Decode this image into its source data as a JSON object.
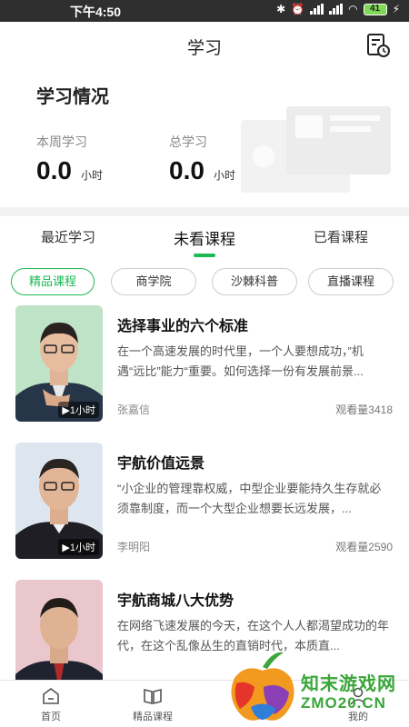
{
  "status_bar": {
    "time": "下午4:50",
    "battery": "41"
  },
  "header": {
    "title": "学习"
  },
  "summary": {
    "heading": "学习情况",
    "week_label": "本周学习",
    "week_value": "0.0",
    "week_unit": "小时",
    "total_label": "总学习",
    "total_value": "0.0",
    "total_unit": "小时"
  },
  "tabs": [
    {
      "label": "最近学习",
      "active": false
    },
    {
      "label": "未看课程",
      "active": true
    },
    {
      "label": "已看课程",
      "active": false
    }
  ],
  "categories": [
    {
      "label": "精品课程",
      "active": true
    },
    {
      "label": "商学院",
      "active": false
    },
    {
      "label": "沙棘科普",
      "active": false
    },
    {
      "label": "直播课程",
      "active": false
    }
  ],
  "courses": [
    {
      "title": "选择事业的六个标准",
      "description": "在一个高速发展的时代里，一个人要想成功，”机遇“远比”能力“重要。如何选择一份有发展前景...",
      "author": "张嘉信",
      "views": "观看量3418",
      "duration": "▶1小时"
    },
    {
      "title": "宇航价值远景",
      "description": "“小企业的管理靠权威，中型企业要能持久生存就必须靠制度，而一个大型企业想要长远发展，...",
      "author": "李明阳",
      "views": "观看量2590",
      "duration": "▶1小时"
    },
    {
      "title": "宇航商城八大优势",
      "description": "在网络飞速发展的今天，在这个人人都渴望成功的年代，在这个乱像丛生的直销时代，本质直...",
      "author": "",
      "views": "",
      "duration": ""
    }
  ],
  "bottom_nav": [
    {
      "label": "首页",
      "icon": "home-icon"
    },
    {
      "label": "精品课程",
      "icon": "book-icon"
    },
    {
      "label": "",
      "icon": "study-icon"
    },
    {
      "label": "我的",
      "icon": "person-icon"
    }
  ],
  "watermark": {
    "line1": "知末游戏网",
    "line2": "ZMO20.CN"
  },
  "colors": {
    "accent": "#1db954",
    "status_bar": "#2f2f2f",
    "divider": "#f2f2f2"
  }
}
